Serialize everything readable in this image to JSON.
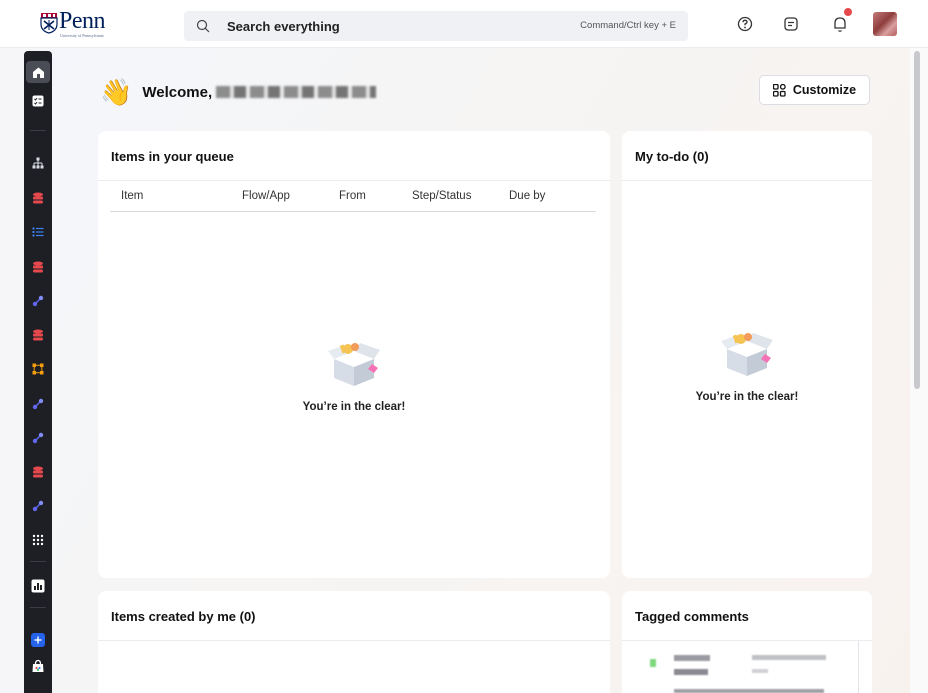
{
  "brand": {
    "wordmark": "Penn",
    "tagline": "University of Pennsylvania",
    "logo_icon": "penn-shield-icon"
  },
  "search": {
    "placeholder": "Search everything",
    "shortcut": "Command/Ctrl key + E",
    "icon": "search-icon"
  },
  "header_icons": [
    "help-icon",
    "messages-icon",
    "notifications-icon"
  ],
  "sidebar": {
    "items": [
      {
        "icon": "home-icon",
        "color": "#ffffff"
      },
      {
        "icon": "tasks-icon",
        "color": "#ffffff"
      },
      {
        "icon": "org-chart-icon",
        "color": "#d9dce3"
      },
      {
        "icon": "database-icon",
        "color": "#e5484d"
      },
      {
        "icon": "list-icon",
        "color": "#3b82f6"
      },
      {
        "icon": "database-icon",
        "color": "#e5484d"
      },
      {
        "icon": "integration-icon",
        "color": "#6366f1"
      },
      {
        "icon": "database-icon",
        "color": "#e5484d"
      },
      {
        "icon": "workflow-icon",
        "color": "#f59e0b"
      },
      {
        "icon": "integration-icon",
        "color": "#6366f1"
      },
      {
        "icon": "integration-icon",
        "color": "#6366f1"
      },
      {
        "icon": "database-icon",
        "color": "#e5484d"
      },
      {
        "icon": "integration-icon",
        "color": "#6366f1"
      },
      {
        "icon": "apps-grid-icon",
        "color": "#ffffff"
      },
      {
        "icon": "reports-icon",
        "color": "#ffffff"
      },
      {
        "icon": "add-icon",
        "color": "#2563eb"
      },
      {
        "icon": "store-icon",
        "color": "#ffffff"
      }
    ]
  },
  "welcome": {
    "greeting": "Welcome,",
    "emoji": "👋"
  },
  "customize_label": "Customize",
  "queue": {
    "title": "Items in your queue",
    "columns": [
      "Item",
      "Flow/App",
      "From",
      "Step/Status",
      "Due by"
    ],
    "empty_message": "You’re in the clear!"
  },
  "todo": {
    "title": "My to-do (0)",
    "empty_message": "You’re in the clear!"
  },
  "created": {
    "title": "Items created by me (0)"
  },
  "tagged": {
    "title": "Tagged comments"
  },
  "colors": {
    "brand_navy": "#011f5b",
    "sidebar_bg": "#1d1f24",
    "notification": "#e5484d"
  }
}
